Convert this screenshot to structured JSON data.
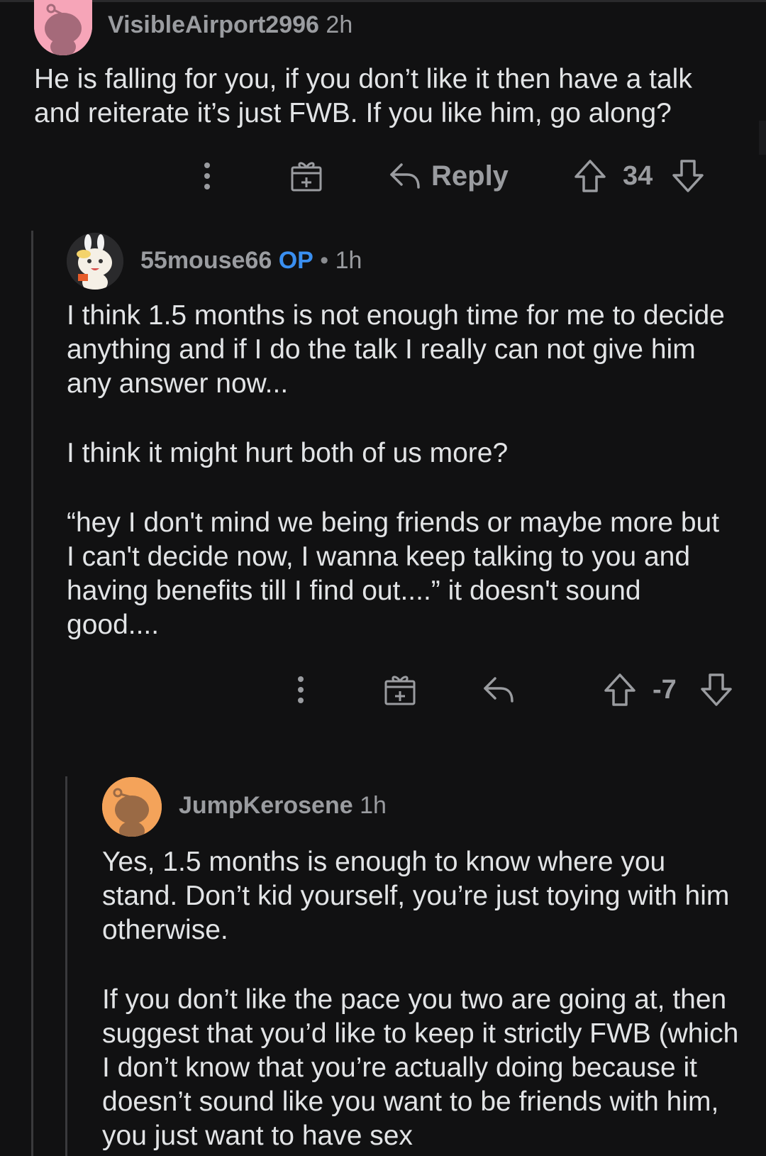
{
  "comments": [
    {
      "username": "VisibleAirport2996",
      "age": "2h",
      "paragraphs": [
        "He is falling for you, if you don’t like it then have a talk and reiterate it’s just FWB. If you like him, go along?"
      ],
      "reply_label": "Reply",
      "score": "34",
      "avatar_color": "#f6a5b8"
    },
    {
      "username": "55mouse66",
      "op_badge": "OP",
      "separator": "•",
      "age": "1h",
      "paragraphs": [
        "I think 1.5 months is not enough time for me to decide anything and if I do the talk I really can not give him any answer now...",
        "I think it might hurt both of us more?",
        "“hey I don't mind we being friends or maybe more but I can't decide now, I wanna keep talking to you and having benefits till I find out....” it doesn't sound good...."
      ],
      "score": "-7",
      "avatar_color": "#2a2a2c"
    },
    {
      "username": "JumpKerosene",
      "age": "1h",
      "paragraphs": [
        "Yes, 1.5 months is enough to know where you stand. Don’t kid yourself, you’re just toying with him otherwise.",
        "If you don’t like the pace you two are going at, then suggest that you’d like to keep it strictly FWB (which I don’t know that you’re actually doing because it doesn’t sound like you want to be friends with him, you just want to have sex"
      ],
      "avatar_color": "#f4a35a"
    }
  ],
  "icons": {
    "more": "more-options-icon",
    "award": "award-icon",
    "reply": "reply-arrow-icon",
    "upvote": "upvote-icon",
    "downvote": "downvote-icon"
  },
  "colors": {
    "background": "#111112",
    "text": "#e2e4e6",
    "meta": "#9a9ca0",
    "op": "#3a8ff0",
    "thread_line": "#3a3a3c"
  }
}
